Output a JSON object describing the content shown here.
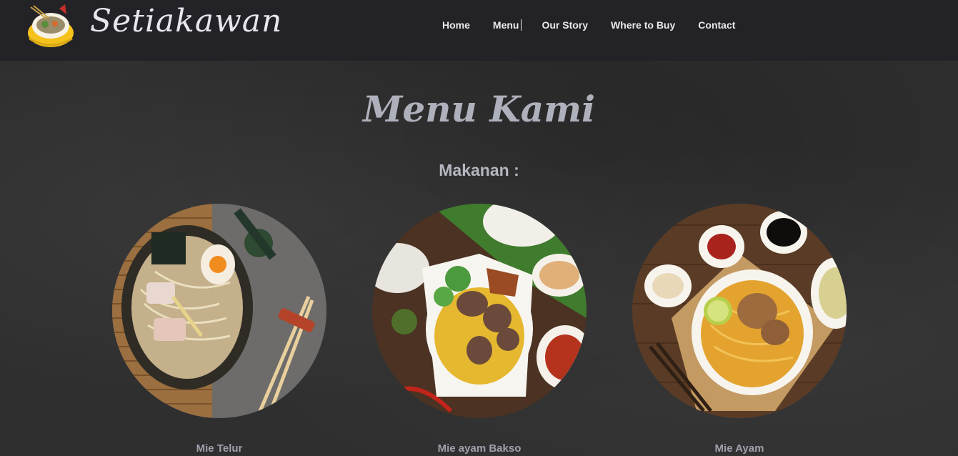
{
  "header": {
    "brand": "Setiakawan",
    "nav": [
      {
        "label": "Home"
      },
      {
        "label": "Menu"
      },
      {
        "label": "Our Story"
      },
      {
        "label": "Where to Buy"
      },
      {
        "label": "Contact"
      }
    ]
  },
  "main": {
    "title": "Menu Kami",
    "section_title": "Makanan :",
    "items": [
      {
        "name": "Mie Telur"
      },
      {
        "name": "Mie ayam Bakso"
      },
      {
        "name": "Mie Ayam"
      }
    ]
  },
  "colors": {
    "navbar": "#232327",
    "background": "#2f2f30",
    "accent_text": "#aeb0bb"
  }
}
